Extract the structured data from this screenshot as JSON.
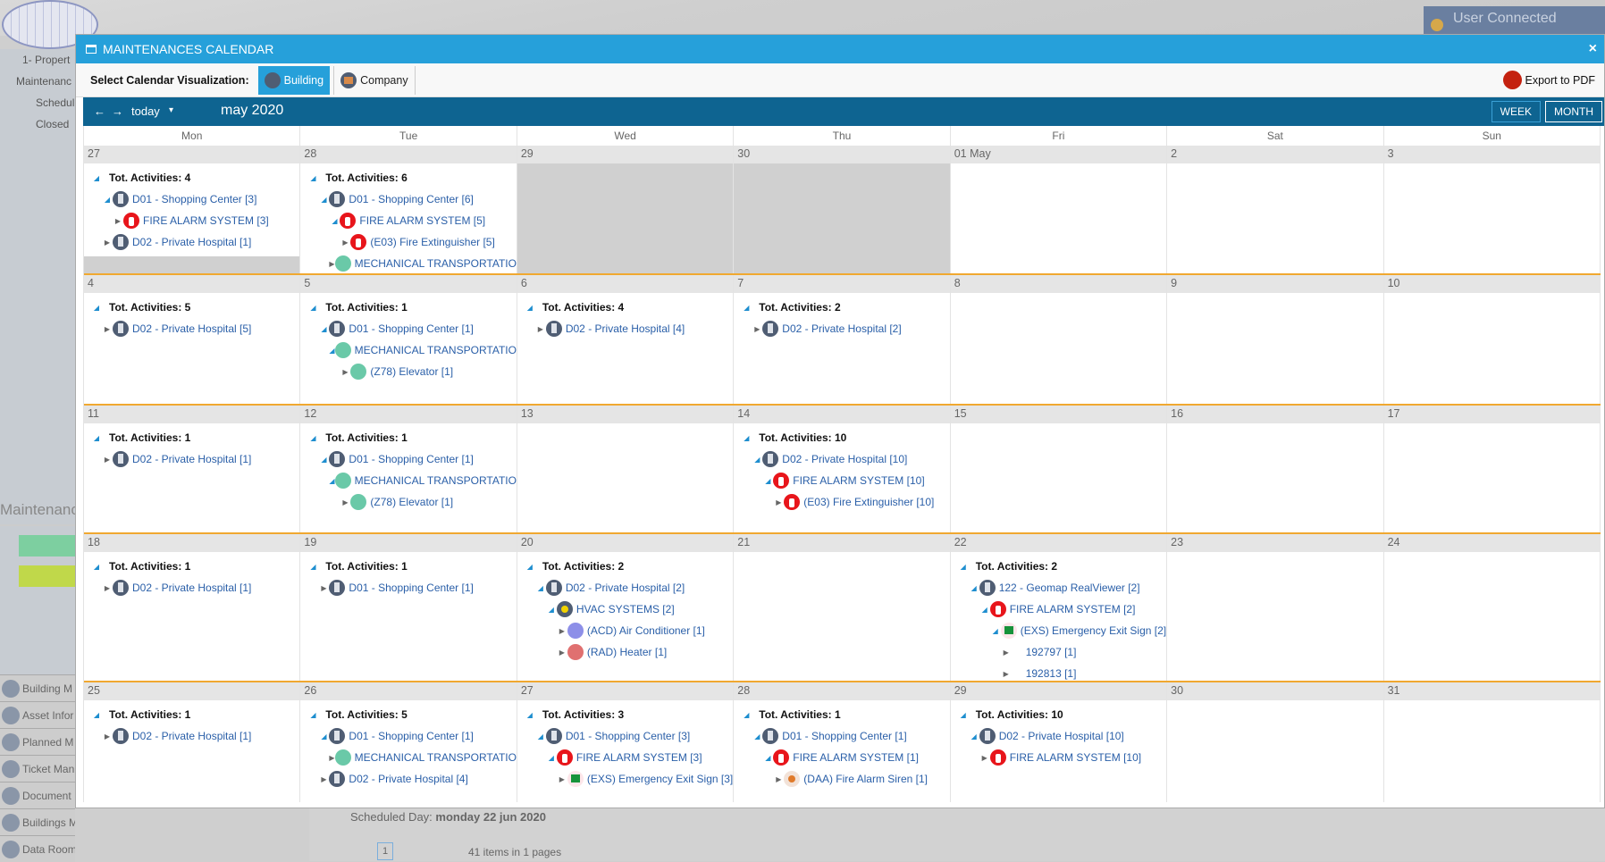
{
  "app": {
    "logo": "GEOMAP",
    "user": "User Connected"
  },
  "sidebar": {
    "items": [
      "1- Propert",
      "Maintenanc",
      "Schedul",
      "Closed"
    ],
    "section": "Maintenanc",
    "legend_colors": [
      "#7dcfa0",
      "#c0d84a"
    ],
    "nav": [
      "Building M",
      "Asset Infor",
      "Planned M",
      "Ticket Man",
      "Document",
      "Buildings Map",
      "Data Room"
    ]
  },
  "background": {
    "scheduled_label": "Scheduled Day:",
    "scheduled_value": "monday 22 jun 2020",
    "page": "1",
    "items_info": "41 items in 1 pages"
  },
  "modal": {
    "title": "MAINTENANCES CALENDAR",
    "close": "×"
  },
  "toolbar": {
    "label": "Select Calendar Visualization:",
    "building": "Building",
    "company": "Company",
    "export": "Export to PDF"
  },
  "calendar": {
    "prev": "←",
    "next": "→",
    "today": "today",
    "dropdown": "▾",
    "month": "may 2020",
    "week": "WEEK",
    "month_view": "MONTH",
    "active_view": "MONTH",
    "dow": [
      "Mon",
      "Tue",
      "Wed",
      "Thu",
      "Fri",
      "Sat",
      "Sun"
    ],
    "days": [
      {
        "n": "27",
        "om": true,
        "tree": {
          "t": "Tot. Activities: 4",
          "c": [
            {
              "l": "D01 - Shopping Center [3]",
              "i": "building",
              "o": true,
              "c": [
                {
                  "l": "FIRE ALARM SYSTEM [3]",
                  "i": "fire"
                }
              ]
            },
            {
              "l": "D02 - Private Hospital [1]",
              "i": "building"
            }
          ]
        }
      },
      {
        "n": "28",
        "om": true,
        "tree": {
          "t": "Tot. Activities: 6",
          "c": [
            {
              "l": "D01 - Shopping Center [6]",
              "i": "building",
              "o": true,
              "c": [
                {
                  "l": "FIRE ALARM SYSTEM [5]",
                  "i": "fire",
                  "o": true,
                  "c": [
                    {
                      "l": "(E03) Fire Extinguisher [5]",
                      "i": "fire"
                    }
                  ]
                },
                {
                  "l": "MECHANICAL TRANSPORTATION",
                  "i": "mech"
                }
              ]
            }
          ]
        }
      },
      {
        "n": "29",
        "om": true
      },
      {
        "n": "30",
        "om": true
      },
      {
        "n": "01 May"
      },
      {
        "n": "2"
      },
      {
        "n": "3"
      },
      {
        "n": "4",
        "tree": {
          "t": "Tot. Activities: 5",
          "c": [
            {
              "l": "D02 - Private Hospital [5]",
              "i": "building"
            }
          ]
        }
      },
      {
        "n": "5",
        "tree": {
          "t": "Tot. Activities: 1",
          "c": [
            {
              "l": "D01 - Shopping Center [1]",
              "i": "building",
              "o": true,
              "c": [
                {
                  "l": "MECHANICAL TRANSPORTATION",
                  "i": "mech",
                  "o": true,
                  "c": [
                    {
                      "l": "(Z78) Elevator [1]",
                      "i": "mech"
                    }
                  ]
                }
              ]
            }
          ]
        }
      },
      {
        "n": "6",
        "tree": {
          "t": "Tot. Activities: 4",
          "c": [
            {
              "l": "D02 - Private Hospital [4]",
              "i": "building"
            }
          ]
        }
      },
      {
        "n": "7",
        "tree": {
          "t": "Tot. Activities: 2",
          "c": [
            {
              "l": "D02 - Private Hospital [2]",
              "i": "building"
            }
          ]
        }
      },
      {
        "n": "8"
      },
      {
        "n": "9"
      },
      {
        "n": "10"
      },
      {
        "n": "11",
        "tree": {
          "t": "Tot. Activities: 1",
          "c": [
            {
              "l": "D02 - Private Hospital [1]",
              "i": "building"
            }
          ]
        }
      },
      {
        "n": "12",
        "tree": {
          "t": "Tot. Activities: 1",
          "c": [
            {
              "l": "D01 - Shopping Center [1]",
              "i": "building",
              "o": true,
              "c": [
                {
                  "l": "MECHANICAL TRANSPORTATION",
                  "i": "mech",
                  "o": true,
                  "c": [
                    {
                      "l": "(Z78) Elevator [1]",
                      "i": "mech"
                    }
                  ]
                }
              ]
            }
          ]
        }
      },
      {
        "n": "13"
      },
      {
        "n": "14",
        "tree": {
          "t": "Tot. Activities: 10",
          "c": [
            {
              "l": "D02 - Private Hospital [10]",
              "i": "building",
              "o": true,
              "c": [
                {
                  "l": "FIRE ALARM SYSTEM [10]",
                  "i": "fire",
                  "o": true,
                  "c": [
                    {
                      "l": "(E03) Fire Extinguisher [10]",
                      "i": "fire"
                    }
                  ]
                }
              ]
            }
          ]
        }
      },
      {
        "n": "15"
      },
      {
        "n": "16"
      },
      {
        "n": "17"
      },
      {
        "n": "18",
        "tree": {
          "t": "Tot. Activities: 1",
          "c": [
            {
              "l": "D02 - Private Hospital [1]",
              "i": "building"
            }
          ]
        }
      },
      {
        "n": "19",
        "tree": {
          "t": "Tot. Activities: 1",
          "c": [
            {
              "l": "D01 - Shopping Center [1]",
              "i": "building"
            }
          ]
        }
      },
      {
        "n": "20",
        "tree": {
          "t": "Tot. Activities: 2",
          "c": [
            {
              "l": "D02 - Private Hospital [2]",
              "i": "building",
              "o": true,
              "c": [
                {
                  "l": "HVAC SYSTEMS [2]",
                  "i": "hvac",
                  "o": true,
                  "c": [
                    {
                      "l": "(ACD) Air Conditioner [1]",
                      "i": "acd"
                    },
                    {
                      "l": "(RAD) Heater [1]",
                      "i": "rad"
                    }
                  ]
                }
              ]
            }
          ]
        }
      },
      {
        "n": "21"
      },
      {
        "n": "22",
        "tree": {
          "t": "Tot. Activities: 2",
          "c": [
            {
              "l": "122 - Geomap RealViewer [2]",
              "i": "building",
              "o": true,
              "c": [
                {
                  "l": "FIRE ALARM SYSTEM [2]",
                  "i": "fire",
                  "o": true,
                  "c": [
                    {
                      "l": "(EXS) Emergency Exit Sign [2]",
                      "i": "exs",
                      "o": true,
                      "c": [
                        {
                          "l": "192797 [1]"
                        },
                        {
                          "l": "192813 [1]"
                        }
                      ]
                    }
                  ]
                }
              ]
            }
          ]
        }
      },
      {
        "n": "23"
      },
      {
        "n": "24"
      },
      {
        "n": "25",
        "tree": {
          "t": "Tot. Activities: 1",
          "c": [
            {
              "l": "D02 - Private Hospital [1]",
              "i": "building"
            }
          ]
        }
      },
      {
        "n": "26",
        "tree": {
          "t": "Tot. Activities: 5",
          "c": [
            {
              "l": "D01 - Shopping Center [1]",
              "i": "building",
              "o": true,
              "c": [
                {
                  "l": "MECHANICAL TRANSPORTATION",
                  "i": "mech"
                }
              ]
            },
            {
              "l": "D02 - Private Hospital [4]",
              "i": "building"
            }
          ]
        }
      },
      {
        "n": "27",
        "tree": {
          "t": "Tot. Activities: 3",
          "c": [
            {
              "l": "D01 - Shopping Center [3]",
              "i": "building",
              "o": true,
              "c": [
                {
                  "l": "FIRE ALARM SYSTEM [3]",
                  "i": "fire",
                  "o": true,
                  "c": [
                    {
                      "l": "(EXS) Emergency Exit Sign [3]",
                      "i": "exs"
                    }
                  ]
                }
              ]
            }
          ]
        }
      },
      {
        "n": "28",
        "tree": {
          "t": "Tot. Activities: 1",
          "c": [
            {
              "l": "D01 - Shopping Center [1]",
              "i": "building",
              "o": true,
              "c": [
                {
                  "l": "FIRE ALARM SYSTEM [1]",
                  "i": "fire",
                  "o": true,
                  "c": [
                    {
                      "l": "(DAA) Fire Alarm Siren [1]",
                      "i": "siren"
                    }
                  ]
                }
              ]
            }
          ]
        }
      },
      {
        "n": "29",
        "tree": {
          "t": "Tot. Activities: 10",
          "c": [
            {
              "l": "D02 - Private Hospital [10]",
              "i": "building",
              "o": true,
              "c": [
                {
                  "l": "FIRE ALARM SYSTEM [10]",
                  "i": "fire"
                }
              ]
            }
          ]
        }
      },
      {
        "n": "30"
      },
      {
        "n": "31"
      }
    ]
  }
}
